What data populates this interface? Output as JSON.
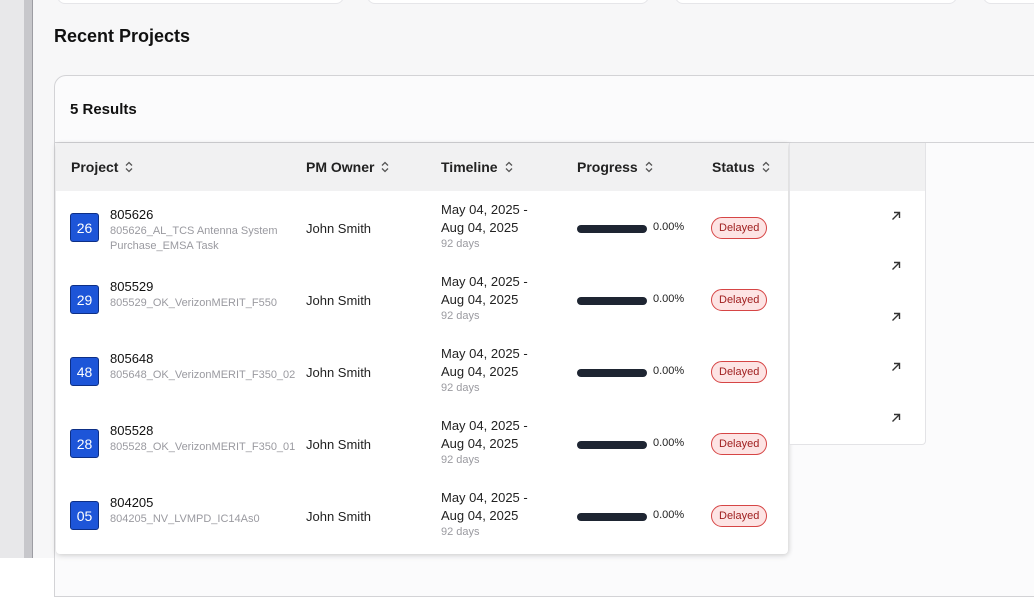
{
  "section_title": "Recent Projects",
  "results_count": "5 Results",
  "columns": {
    "project": "Project",
    "pm_owner": "PM Owner",
    "timeline": "Timeline",
    "progress": "Progress",
    "status": "Status"
  },
  "rows": [
    {
      "badge": "26",
      "id": "805626",
      "name": "805626_AL_TCS Antenna System Purchase_EMSA Task",
      "owner": "John Smith",
      "start": "May 04, 2025 -",
      "end": "Aug 04, 2025",
      "days": "92 days",
      "progress": "0.00%",
      "status": "Delayed"
    },
    {
      "badge": "29",
      "id": "805529",
      "name": "805529_OK_VerizonMERIT_F550",
      "owner": "John Smith",
      "start": "May 04, 2025 -",
      "end": "Aug 04, 2025",
      "days": "92 days",
      "progress": "0.00%",
      "status": "Delayed"
    },
    {
      "badge": "48",
      "id": "805648",
      "name": "805648_OK_VerizonMERIT_F350_02",
      "owner": "John Smith",
      "start": "May 04, 2025 -",
      "end": "Aug 04, 2025",
      "days": "92 days",
      "progress": "0.00%",
      "status": "Delayed"
    },
    {
      "badge": "28",
      "id": "805528",
      "name": "805528_OK_VerizonMERIT_F350_01",
      "owner": "John Smith",
      "start": "May 04, 2025 -",
      "end": "Aug 04, 2025",
      "days": "92 days",
      "progress": "0.00%",
      "status": "Delayed"
    },
    {
      "badge": "05",
      "id": "804205",
      "name": "804205_NV_LVMPD_IC14As0",
      "owner": "John Smith",
      "start": "May 04, 2025 -",
      "end": "Aug 04, 2025",
      "days": "92 days",
      "progress": "0.00%",
      "status": "Delayed"
    }
  ],
  "colors": {
    "badge": "#1d55d8",
    "progress_bar": "#1e2532",
    "status_delayed_bg": "#fde4e4",
    "status_delayed_border": "#d64545"
  },
  "icons": {
    "sort": "sort-updown-icon",
    "open": "arrow-up-right-icon"
  }
}
